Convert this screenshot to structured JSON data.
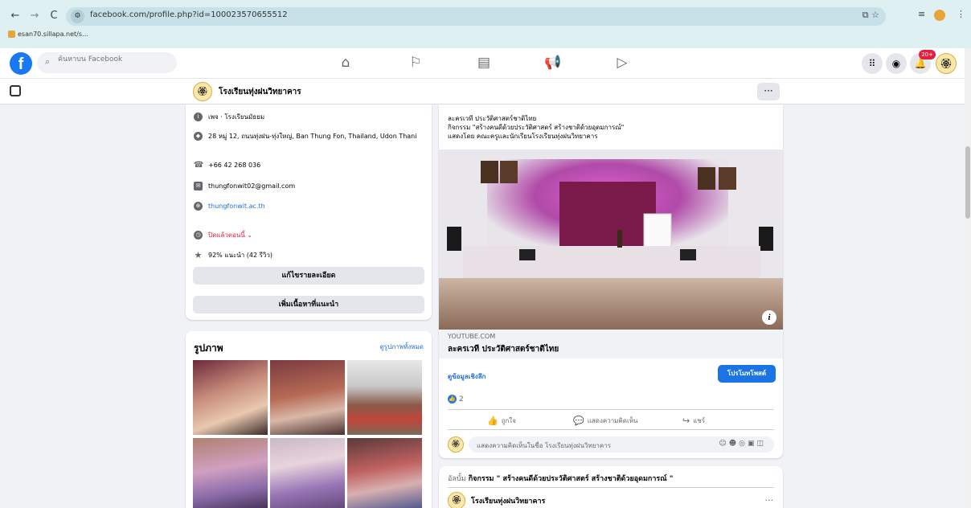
{
  "browser": {
    "url": "facebook.com/profile.php?id=100023570655512",
    "bookmark": "esan70.sillapa.net/s..."
  },
  "fb_header": {
    "search_placeholder": "ค้นหาบน Facebook",
    "notification_count": "20+"
  },
  "page": {
    "name": "โรงเรียนทุ่งฝนวิทยาคาร"
  },
  "info": {
    "category": "เพจ · โรงเรียนมัธยม",
    "address": "28 หมู่ 12, ถนนทุ่งฝน-ทุ่งใหญ่, Ban Thung Fon, Thailand, Udon Thani",
    "phone": "+66 42 268 036",
    "email": "thungfonwit02@gmail.com",
    "website": "thungfonwit.ac.th",
    "hours": "ปิดแล้วตอนนี้ ⌄",
    "rating": "92% แนะนำ (42 รีวิว)",
    "edit_details_label": "แก้ไขรายละเอียด",
    "add_featured_label": "เพิ่มเนื้อหาที่แนะนำ"
  },
  "photos": {
    "title": "รูปภาพ",
    "see_all": "ดูรูปภาพทั้งหมด"
  },
  "post": {
    "line1": "ละครเวที ประวัติศาสตร์ชาติไทย",
    "line2": "กิจกรรม \"สร้างคนดีด้วยประวัติศาสตร์ สร้างชาติด้วยอุดมการณ์\"",
    "line3": "แสดงโดย คณะครูและนักเรียนโรงเรียนทุ่งฝนวิทยาคาร",
    "link_domain": "YOUTUBE.COM",
    "link_title": "ละครเวที ประวัติศาสตร์ชาติไทย",
    "insights_label": "ดูข้อมูลเชิงลึก",
    "promote_label": "โปรโมทโพสต์",
    "reaction_count": "2",
    "like_label": "ถูกใจ",
    "comment_label": "แสดงความคิดเห็น",
    "share_label": "แชร์",
    "comment_placeholder": "แสดงความคิดเห็นในชื่อ โรงเรียนทุ่งฝนวิทยาคาร"
  },
  "post2": {
    "album_prefix": "อัลบั้ม",
    "album_title": "กิจกรรม \" สร้างคนดีด้วยประวัติศาสตร์ สร้างชาติด้วยอุดมการณ์ \"",
    "author": "โรงเรียนทุ่งฝนวิทยาคาร"
  },
  "colors": {
    "fb_blue": "#1877f2",
    "link_blue": "#216fdb",
    "background": "#f0f2f5",
    "alert_red": "#e41e3f"
  }
}
